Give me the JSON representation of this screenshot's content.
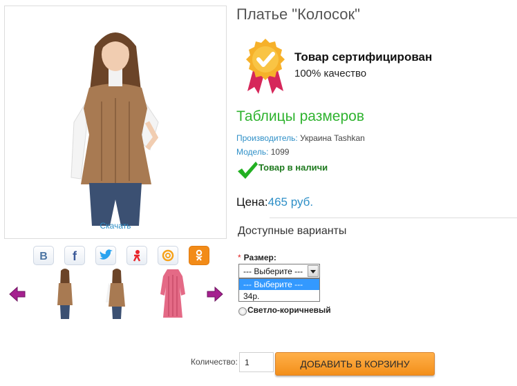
{
  "product": {
    "title": "Платье \"Колосок\"",
    "download_label": "Скачать"
  },
  "certificate": {
    "title": "Товар сертифицирован",
    "subtitle": "100% качество",
    "icon": "certified-badge-icon"
  },
  "size_table_link": "Таблицы размеров",
  "manufacturer": {
    "label": "Производитель:",
    "value": "Украина Tashkan"
  },
  "model": {
    "label": "Модель:",
    "value": "1099"
  },
  "stock": {
    "text": "Товар в наличи",
    "icon": "checkmark-icon"
  },
  "price": {
    "label": "Цена:",
    "value": "465 руб."
  },
  "variants": {
    "title": "Доступные варианты",
    "size_label": "Размер:",
    "required_mark": "*",
    "selected_text": "--- Выберите ---",
    "options": [
      "--- Выберите ---",
      "34р."
    ],
    "color_option": "Светло-коричневый"
  },
  "quantity": {
    "label": "Количество:",
    "value": "1"
  },
  "cart_button": "ДОБАВИТЬ В КОРЗИНУ",
  "social": [
    {
      "name": "vk-icon",
      "color": "#4c75a3"
    },
    {
      "name": "facebook-icon",
      "color": "#3b5998"
    },
    {
      "name": "twitter-icon",
      "color": "#2aa3ef"
    },
    {
      "name": "odnoklassniki-icon",
      "color": "#e8262b"
    },
    {
      "name": "mailru-icon",
      "color": "#f7a21a"
    },
    {
      "name": "ok-icon",
      "color": "#f28b18"
    }
  ],
  "colors": {
    "accent_blue": "#2e8fc7",
    "size_link_green": "#2fb32f",
    "stock_green": "#1f7a1f",
    "cart_orange": "#f38f1a"
  }
}
